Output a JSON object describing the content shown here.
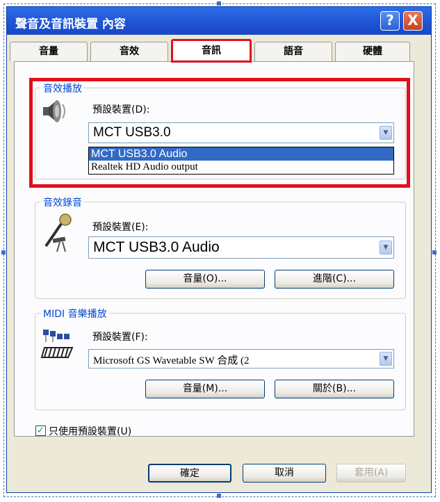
{
  "window": {
    "title": "聲音及音訊裝置 內容",
    "help_glyph": "?",
    "close_glyph": "X"
  },
  "tabs": [
    {
      "label": "音量"
    },
    {
      "label": "音效"
    },
    {
      "label": "音訊",
      "active": true
    },
    {
      "label": "語音"
    },
    {
      "label": "硬體"
    }
  ],
  "playback": {
    "group_label": "音效播放",
    "device_label": "預設裝置(D):",
    "selected_value": "MCT USB3.0",
    "dropdown_options": [
      "MCT USB3.0 Audio",
      "Realtek HD Audio output"
    ],
    "highlighted_option": "MCT USB3.0 Audio"
  },
  "recording": {
    "group_label": "音效錄音",
    "device_label": "預設裝置(E):",
    "selected_value": "MCT USB3.0 Audio",
    "volume_button": "音量(O)...",
    "advanced_button": "進階(C)..."
  },
  "midi": {
    "group_label": "MIDI 音樂播放",
    "device_label": "預設裝置(F):",
    "selected_value": "Microsoft GS Wavetable SW 合成 (2",
    "volume_button": "音量(M)...",
    "about_button": "關於(B)..."
  },
  "use_default_only": {
    "label": "只使用預設裝置(U)",
    "checked": true,
    "check_glyph": "✓"
  },
  "footer": {
    "ok": "確定",
    "cancel": "取消",
    "apply": "套用(A)"
  },
  "arrow_glyph": "▼",
  "colors": {
    "titlebar": "#1f54d6",
    "highlight_box": "#e0101c",
    "selection": "#316ac5",
    "group_label": "#0046d5"
  }
}
